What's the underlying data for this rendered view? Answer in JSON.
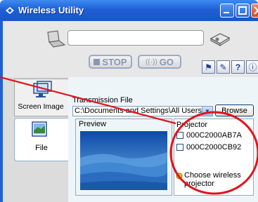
{
  "window": {
    "title": "Wireless Utility",
    "colors": {
      "titlebar": "#1f5fd6",
      "annotation": "#e0141e"
    }
  },
  "toolbar": {
    "stop_label": "STOP",
    "go_label": "GO",
    "go_icon": "((·))",
    "tools": [
      {
        "icon": "network-icon",
        "glyph": "⚑"
      },
      {
        "icon": "settings-icon",
        "glyph": "✎"
      },
      {
        "icon": "help-icon",
        "glyph": "?"
      },
      {
        "icon": "info-icon",
        "glyph": "ⓘ"
      }
    ]
  },
  "sidebar": {
    "tabs": [
      {
        "label": "Screen Image",
        "icon": "screen-image-icon",
        "selected": false
      },
      {
        "label": "File",
        "icon": "file-icon",
        "selected": true
      }
    ]
  },
  "main": {
    "transmission_label": "Transmission File",
    "path_value": "C:\\Documents and Settings\\All Users",
    "browse_label": "Browse",
    "preview_label": "Preview",
    "projector_label": "Projector",
    "projectors": [
      {
        "name": "000C2000AB7A",
        "checked": false
      },
      {
        "name": "000C2000CB92",
        "checked": false
      }
    ],
    "choose_text": "Choose wireless projector"
  }
}
